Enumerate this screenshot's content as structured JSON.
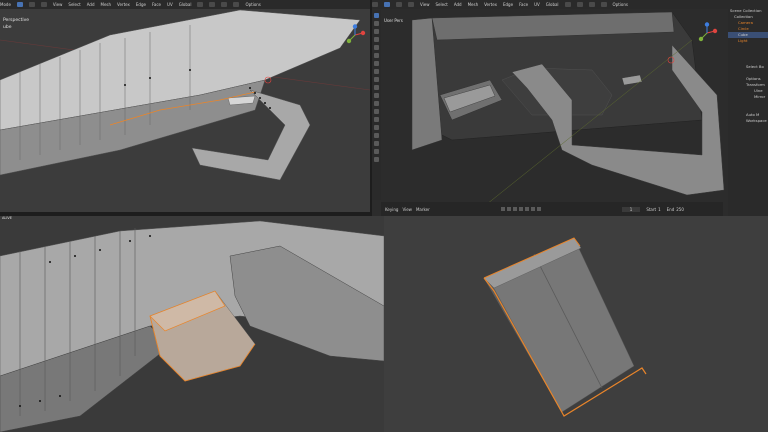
{
  "top_left": {
    "menu": [
      "Mode",
      "View",
      "Select",
      "Add",
      "Mesh",
      "Vertex",
      "Edge",
      "Face",
      "UV"
    ],
    "transform": "Global",
    "options": "Options",
    "view_info": [
      "Perspective",
      "ube"
    ]
  },
  "top_right": {
    "menu": [
      "View",
      "Select",
      "Add",
      "Mesh",
      "Vertex",
      "Edge",
      "Face",
      "UV"
    ],
    "transform": "Global",
    "options": "Options",
    "view_label": "User Pers",
    "timeline": {
      "menu": [
        "Keying",
        "View",
        "Marker"
      ],
      "current_frame": "1",
      "start_label": "Start",
      "start": "1",
      "end_label": "End",
      "end": "250"
    },
    "outliner": {
      "items": [
        "Scene Collection",
        "Collection",
        "Camera",
        "Circle",
        "Cube",
        "Light"
      ]
    },
    "properties": {
      "items": [
        "Select Bo",
        "Options",
        "Transform",
        "Mirror",
        "Auto M",
        "Workspace"
      ],
      "sub": [
        "Ulne",
        "Mirror"
      ]
    }
  },
  "bottom_left": {
    "label": "ALIVE"
  },
  "colors": {
    "selection_orange": "#e9852a",
    "active_blue": "#4772b3",
    "mesh_gray": "#b4b4b4",
    "x_axis": "#e0443f",
    "y_axis": "#7fb23b",
    "z_axis": "#3e7ee0"
  }
}
